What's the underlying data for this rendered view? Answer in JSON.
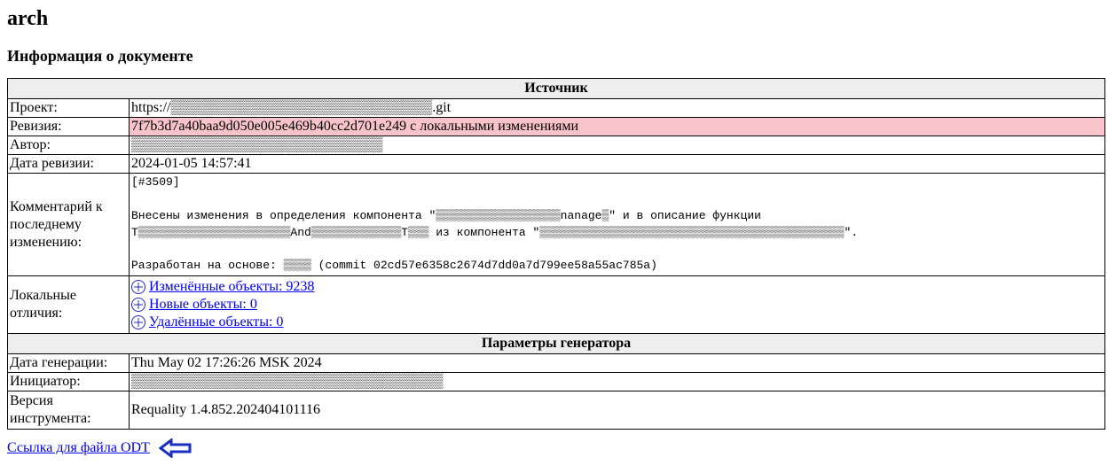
{
  "heading": "arch",
  "section_title": "Информация о документе",
  "source": {
    "header": "Источник",
    "project_label": "Проект:",
    "project_value": "https://▒▒▒▒▒▒▒▒▒▒▒▒▒▒▒▒▒▒▒▒▒▒▒▒▒▒.git",
    "revision_label": "Ревизия:",
    "revision_value": "7f7b3d7a40baa9d050e005e469b40cc2d701e249 с локальными изменениями",
    "author_label": "Автор:",
    "author_value": "▒▒▒▒▒▒▒▒▒▒▒▒▒▒▒▒▒▒▒▒▒▒▒▒▒",
    "rev_date_label": "Дата ревизии:",
    "rev_date_value": "2024-01-05 14:57:41",
    "comment_label": "Комментарий к последнему изменению:",
    "comment_value": "[#3509]\n\nВнесены изменения в определения компонента \"▒▒▒▒▒▒▒▒▒▒▒▒▒▒▒▒▒▒nanage▒\" и в описание функции\nT▒▒▒▒▒▒▒▒▒▒▒▒▒▒▒▒▒▒▒▒▒▒And▒▒▒▒▒▒▒▒▒▒▒▒▒T▒▒▒ из компонента \"▒▒▒▒▒▒▒▒▒▒▒▒▒▒▒▒▒▒▒▒▒▒▒▒▒▒▒▒▒▒▒▒▒▒▒▒▒▒▒▒▒▒▒▒\".\n\nРазработан на основе: ▒▒▒▒ (commit 02cd57e6358c2674d7dd0a7d799ee58a55ac785a)",
    "local_diff_label": "Локальные отличия:",
    "local_diff": {
      "changed": "Изменённые объекты: 9238",
      "new": "Новые объекты: 0",
      "deleted": "Удалённые объекты: 0"
    }
  },
  "generator": {
    "header": "Параметры генератора",
    "gen_date_label": "Дата генерации:",
    "gen_date_value": "Thu May 02 17:26:26 MSK 2024",
    "initiator_label": "Инициатор:",
    "initiator_value": "▒▒▒▒▒▒▒▒▒▒▒▒▒▒▒▒▒▒▒▒▒▒▒▒▒▒▒▒▒▒▒",
    "tool_version_label": "Версия инструмента:",
    "tool_version_value": "Requality 1.4.852.202404101116"
  },
  "odt_link_text": "Ссылка для файла ODT"
}
